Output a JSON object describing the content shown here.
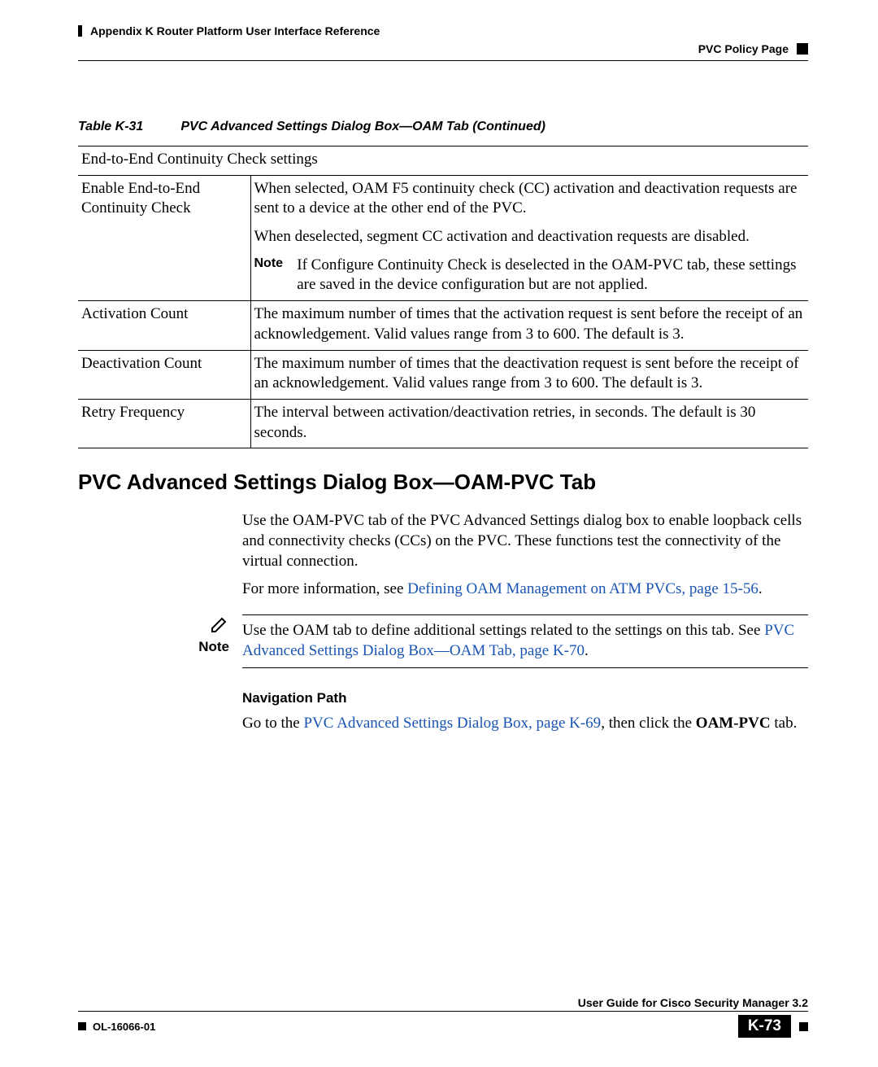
{
  "header": {
    "left": "Appendix K      Router Platform User Interface Reference",
    "right": "PVC Policy Page"
  },
  "table": {
    "caption_num": "Table K-31",
    "caption_title": "PVC Advanced Settings Dialog Box—OAM Tab (Continued)",
    "section_header": "End-to-End Continuity Check settings",
    "rows": {
      "r1_label": "Enable End-to-End Continuity Check",
      "r1_p1": "When selected, OAM F5 continuity check (CC) activation and deactivation requests are sent to a device at the other end of the PVC.",
      "r1_p2": "When deselected, segment CC activation and deactivation requests are disabled.",
      "r1_note_label": "Note",
      "r1_note": "If Configure Continuity Check is deselected in the OAM-PVC tab, these settings are saved in the device configuration but are not applied.",
      "r2_label": "Activation Count",
      "r2_text": "The maximum number of times that the activation request is sent before the receipt of an acknowledgement. Valid values range from 3 to 600. The default is 3.",
      "r3_label": "Deactivation Count",
      "r3_text": "The maximum number of times that the deactivation request is sent before the receipt of an acknowledgement. Valid values range from 3 to 600. The default is 3.",
      "r4_label": "Retry Frequency",
      "r4_text": "The interval between activation/deactivation retries, in seconds. The default is 30 seconds."
    }
  },
  "section": {
    "title": "PVC Advanced Settings Dialog Box—OAM-PVC Tab",
    "p1": "Use the OAM-PVC tab of the PVC Advanced Settings dialog box to enable loopback cells and connectivity checks (CCs) on the PVC. These functions test the connectivity of the virtual connection.",
    "p2_pre": "For more information, see ",
    "p2_link": "Defining OAM Management on ATM PVCs, page 15-56",
    "p2_post": ".",
    "note_label": "Note",
    "note_pre": "Use the OAM tab to define additional settings related to the settings on this tab. See ",
    "note_link": "PVC Advanced Settings Dialog Box—OAM Tab, page K-70",
    "note_post": ".",
    "nav_heading": "Navigation Path",
    "nav_pre": "Go to the ",
    "nav_link": "PVC Advanced Settings Dialog Box, page K-69",
    "nav_mid": ", then click the ",
    "nav_bold": "OAM-PVC",
    "nav_post": " tab."
  },
  "footer": {
    "guide": "User Guide for Cisco Security Manager 3.2",
    "doc": "OL-16066-01",
    "page": "K-73"
  }
}
